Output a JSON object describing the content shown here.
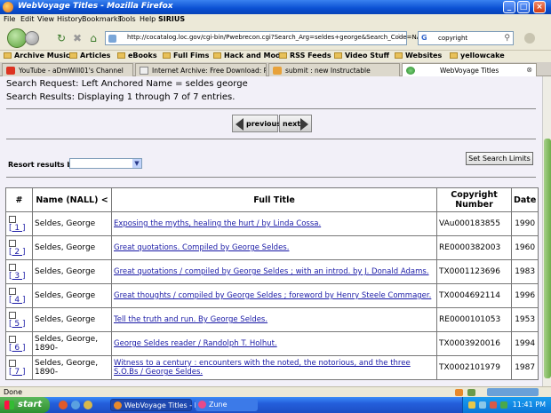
{
  "window": {
    "title": "WebVoyage Titles - Mozilla Firefox"
  },
  "menu": [
    "File",
    "Edit",
    "View",
    "History",
    "Bookmarks",
    "Tools",
    "Help",
    "SIRIUS"
  ],
  "nav": {
    "url": "http://cocatalog.loc.gov/cgi-bin/Pwebrecon.cgi?Search_Arg=seldes+george&Search_Code=NALL&PI",
    "search_value": "copyright",
    "search_engine": "G"
  },
  "bookmarks": [
    "Archive Music",
    "Articles",
    "eBooks",
    "Full Fims",
    "Hack and Mod",
    "RSS Feeds",
    "Video Stuff",
    "Websites",
    "yellowcake"
  ],
  "tabs": [
    {
      "label": "YouTube - aDmWill01's Channel",
      "active": false
    },
    {
      "label": "Internet Archive: Free Download: PE...",
      "active": false
    },
    {
      "label": "submit : new Instructable",
      "active": false
    },
    {
      "label": "WebVoyage Titles",
      "active": true
    }
  ],
  "page": {
    "search_request": "Search Request: Left Anchored Name = seldes george",
    "search_results": "Search Results: Displaying 1 through 7 of 7 entries.",
    "prev_label": "previous",
    "next_label": "next",
    "resort_label": "Resort results by:",
    "set_limits_label": "Set Search Limits",
    "table": {
      "headers": [
        "#",
        "Name (NALL) <",
        "Full Title",
        "Copyright Number",
        "Date"
      ],
      "rows": [
        {
          "num": "[ 1 ]",
          "name": "Seldes, George",
          "title": "Exposing the myths, healing the hurt / by Linda Cossa.",
          "copyright": "VAu000183855",
          "date": "1990"
        },
        {
          "num": "[ 2 ]",
          "name": "Seldes, George",
          "title": "Great quotations. Compiled by George Seldes.",
          "copyright": "RE0000382003",
          "date": "1960"
        },
        {
          "num": "[ 3 ]",
          "name": "Seldes, George",
          "title": "Great quotations / compiled by George Seldes ; with an introd. by J. Donald Adams.",
          "copyright": "TX0001123696",
          "date": "1983"
        },
        {
          "num": "[ 4 ]",
          "name": "Seldes, George",
          "title": "Great thoughts / compiled by George Seldes ; foreword by Henry Steele Commager.",
          "copyright": "TX0004692114",
          "date": "1996"
        },
        {
          "num": "[ 5 ]",
          "name": "Seldes, George",
          "title": "Tell the truth and run. By George Seldes.",
          "copyright": "RE0000101053",
          "date": "1953"
        },
        {
          "num": "[ 6 ]",
          "name": "Seldes, George, 1890-",
          "title": "George Seldes reader / Randolph T. Holhut.",
          "copyright": "TX0003920016",
          "date": "1994"
        },
        {
          "num": "[ 7 ]",
          "name": "Seldes, George, 1890-",
          "title": "Witness to a century : encounters with the noted, the notorious, and the three S.O.Bs / George Seldes.",
          "copyright": "TX0002101979",
          "date": "1987"
        }
      ]
    }
  },
  "status": {
    "text": "Done"
  },
  "taskbar": {
    "start": "start",
    "tasks": [
      "WebVoyage Titles - M...",
      "Zune"
    ],
    "clock": "11:41 PM"
  }
}
